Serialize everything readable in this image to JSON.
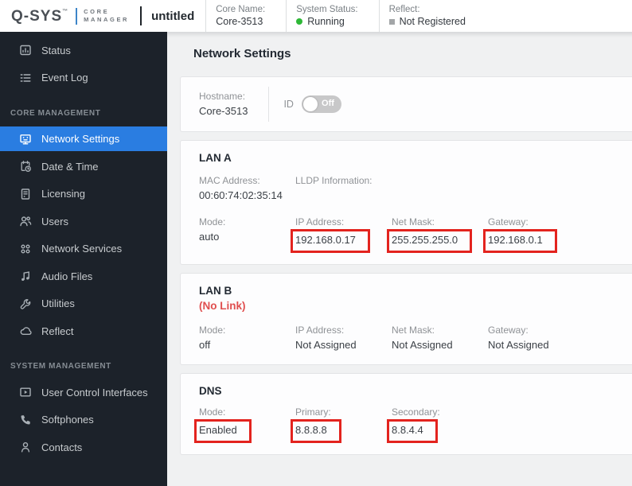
{
  "topbar": {
    "brand": "Q-SYS",
    "brand_tm": "™",
    "product": {
      "line1": "CORE",
      "line2": "MANAGER"
    },
    "design_name": "untitled",
    "core_name": {
      "label": "Core Name:",
      "value": "Core-3513"
    },
    "system_status": {
      "label": "System Status:",
      "value": "Running"
    },
    "reflect": {
      "label": "Reflect:",
      "value": "Not Registered"
    }
  },
  "sidebar": {
    "sections": [
      {
        "title": "",
        "items": [
          {
            "label": "Status",
            "icon": "status-icon"
          },
          {
            "label": "Event Log",
            "icon": "event-log-icon"
          }
        ]
      },
      {
        "title": "CORE MANAGEMENT",
        "items": [
          {
            "label": "Network Settings",
            "icon": "network-settings-icon",
            "active": true
          },
          {
            "label": "Date & Time",
            "icon": "date-time-icon"
          },
          {
            "label": "Licensing",
            "icon": "licensing-icon"
          },
          {
            "label": "Users",
            "icon": "users-icon"
          },
          {
            "label": "Network Services",
            "icon": "network-services-icon"
          },
          {
            "label": "Audio Files",
            "icon": "audio-files-icon"
          },
          {
            "label": "Utilities",
            "icon": "utilities-icon"
          },
          {
            "label": "Reflect",
            "icon": "reflect-icon"
          }
        ]
      },
      {
        "title": "SYSTEM MANAGEMENT",
        "items": [
          {
            "label": "User Control Interfaces",
            "icon": "user-control-interfaces-icon"
          },
          {
            "label": "Softphones",
            "icon": "softphones-icon"
          },
          {
            "label": "Contacts",
            "icon": "contacts-icon"
          }
        ]
      }
    ]
  },
  "main": {
    "title": "Network Settings",
    "hostname_card": {
      "hostname_label": "Hostname:",
      "hostname_value": "Core-3513",
      "id_label": "ID",
      "id_state": "Off"
    },
    "lan_a": {
      "title": "LAN A",
      "mac": {
        "label": "MAC Address:",
        "value": "00:60:74:02:35:14"
      },
      "lldp": {
        "label": "LLDP Information:",
        "value": ""
      },
      "fields": [
        {
          "label": "Mode:",
          "value": "auto",
          "highlight": false
        },
        {
          "label": "IP Address:",
          "value": "192.168.0.17",
          "highlight": true
        },
        {
          "label": "Net Mask:",
          "value": "255.255.255.0",
          "highlight": true
        },
        {
          "label": "Gateway:",
          "value": "192.168.0.1",
          "highlight": true
        }
      ]
    },
    "lan_b": {
      "title": "LAN B",
      "status": "(No Link)",
      "fields": [
        {
          "label": "Mode:",
          "value": "off",
          "highlight": false
        },
        {
          "label": "IP Address:",
          "value": "Not Assigned",
          "highlight": false
        },
        {
          "label": "Net Mask:",
          "value": "Not Assigned",
          "highlight": false
        },
        {
          "label": "Gateway:",
          "value": "Not Assigned",
          "highlight": false
        }
      ]
    },
    "dns": {
      "title": "DNS",
      "fields": [
        {
          "label": "Mode:",
          "value": "Enabled",
          "highlight": true
        },
        {
          "label": "Primary:",
          "value": "8.8.8.8",
          "highlight": true
        },
        {
          "label": "Secondary:",
          "value": "8.8.4.4",
          "highlight": true
        }
      ]
    }
  },
  "colors": {
    "accent_blue": "#2a7de1",
    "status_green": "#2eb837",
    "annotation_red": "#e3231e",
    "no_link_red": "#e04f4f",
    "sidebar_bg": "#1c222a"
  }
}
